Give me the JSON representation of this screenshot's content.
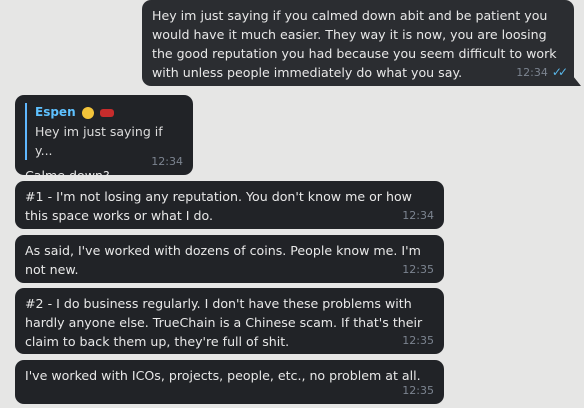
{
  "messages": [
    {
      "direction": "outgoing",
      "text": "Hey im just saying if you calmed down abit and be patient you would have it much easier. They way it is now, you are loosing the good reputation you had because you seem difficult to work with unless people immediately do what you say.",
      "time": "12:34",
      "status": "double-check-read"
    },
    {
      "direction": "incoming",
      "reply_to": {
        "name": "Espen",
        "snippet": "Hey im just saying if y..."
      },
      "text": "Calme down?",
      "time": "12:34"
    },
    {
      "direction": "incoming",
      "text": "#1 - I'm not losing any reputation. You don't know me or how this space works or what I do.",
      "time": "12:34"
    },
    {
      "direction": "incoming",
      "text": "As said, I've worked with dozens of coins. People know me. I'm not new.",
      "time": "12:35"
    },
    {
      "direction": "incoming",
      "text": "#2 - I do business regularly. I don't have these problems with hardly anyone else. TrueChain is a Chinese scam. If that's their claim to back them up, they're full of shit.",
      "time": "12:35"
    },
    {
      "direction": "incoming",
      "text": "I've worked with ICOs, projects, people, etc., no problem at all.",
      "time": "12:35"
    }
  ],
  "colors": {
    "background": "#e6e6e5",
    "bubble_incoming": "#212327",
    "bubble_outgoing": "#2b2d31",
    "reply_name": "#5ec1ff",
    "check_read": "#59b7e9"
  },
  "icons": {
    "read_status": "double-check-icon",
    "reply_emoji_1": "moon-emoji",
    "reply_emoji_2": "race-car-emoji"
  }
}
